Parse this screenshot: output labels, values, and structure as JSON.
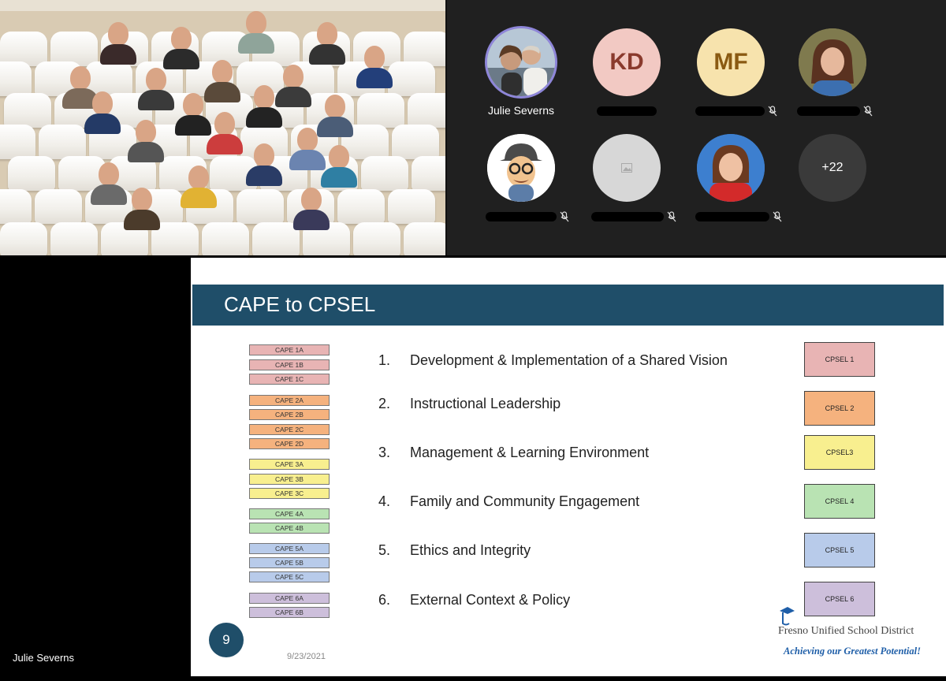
{
  "meeting": {
    "presenter_name": "Julie Severns"
  },
  "participants": {
    "tiles": [
      {
        "name": "Julie Severns",
        "initials": "",
        "color": "#dcdce0",
        "photo": "couple-photo-icon",
        "muted": false,
        "name_visible": true
      },
      {
        "name": "",
        "initials": "KD",
        "color": "#f2c9c3",
        "text_color": "#8a3a2d",
        "muted": false,
        "name_visible": false
      },
      {
        "name": "",
        "initials": "MF",
        "color": "#f7e3ad",
        "text_color": "#8a5a12",
        "muted": true,
        "name_visible": false
      },
      {
        "name": "",
        "initials": "",
        "color": "#9b8b6a",
        "photo": "woman-photo-icon",
        "muted": true,
        "name_visible": false
      },
      {
        "name": "",
        "initials": "",
        "color": "#ffffff",
        "photo": "cartoon-avatar-icon",
        "muted": true,
        "name_visible": false
      },
      {
        "name": "",
        "initials": "",
        "color": "#d7d7d7",
        "photo": "image-placeholder-icon",
        "muted": true,
        "name_visible": false
      },
      {
        "name": "",
        "initials": "",
        "color": "#3b7fd0",
        "photo": "woman-red-photo-icon",
        "muted": true,
        "name_visible": false
      }
    ],
    "overflow_label": "+22"
  },
  "slide": {
    "title": "CAPE to CPSEL",
    "page_number": "9",
    "date": "9/23/2021",
    "logo_name": "Fresno Unified School District",
    "logo_tagline": "Achieving our Greatest Potential!",
    "cape_boxes": [
      {
        "label": "CAPE 1A",
        "color": "#e8b4b4"
      },
      {
        "label": "CAPE 1B",
        "color": "#e8b4b4"
      },
      {
        "label": "CAPE 1C",
        "color": "#e8b4b4"
      },
      {
        "label": "CAPE 2A",
        "color": "#f5b27e"
      },
      {
        "label": "CAPE 2B",
        "color": "#f5b27e"
      },
      {
        "label": "CAPE 2C",
        "color": "#f5b27e"
      },
      {
        "label": "CAPE 2D",
        "color": "#f5b27e"
      },
      {
        "label": "CAPE 3A",
        "color": "#f8ef8f"
      },
      {
        "label": "CAPE 3B",
        "color": "#f8ef8f"
      },
      {
        "label": "CAPE 3C",
        "color": "#f8ef8f"
      },
      {
        "label": "CAPE 4A",
        "color": "#b9e3b3"
      },
      {
        "label": "CAPE 4B",
        "color": "#b9e3b3"
      },
      {
        "label": "CAPE 5A",
        "color": "#b8cbea"
      },
      {
        "label": "CAPE 5B",
        "color": "#b8cbea"
      },
      {
        "label": "CAPE 5C",
        "color": "#b8cbea"
      },
      {
        "label": "CAPE 6A",
        "color": "#cdbfdb"
      },
      {
        "label": "CAPE 6B",
        "color": "#cdbfdb"
      }
    ],
    "items": [
      {
        "num": "1.",
        "text": "Development & Implementation of a Shared Vision"
      },
      {
        "num": "2.",
        "text": "Instructional Leadership"
      },
      {
        "num": "3.",
        "text": "Management & Learning Environment"
      },
      {
        "num": "4.",
        "text": "Family and Community Engagement"
      },
      {
        "num": "5.",
        "text": "Ethics and Integrity"
      },
      {
        "num": "6.",
        "text": "External Context & Policy"
      }
    ],
    "cpsel_boxes": [
      {
        "label": "CPSEL 1",
        "color": "#e8b4b4"
      },
      {
        "label": "CPSEL 2",
        "color": "#f5b27e"
      },
      {
        "label": "CPSEL3",
        "color": "#f8ef8f"
      },
      {
        "label": "CPSEL 4",
        "color": "#b9e3b3"
      },
      {
        "label": "CPSEL 5",
        "color": "#b8cbea"
      },
      {
        "label": "CPSEL 6",
        "color": "#cdbfdb"
      }
    ]
  }
}
